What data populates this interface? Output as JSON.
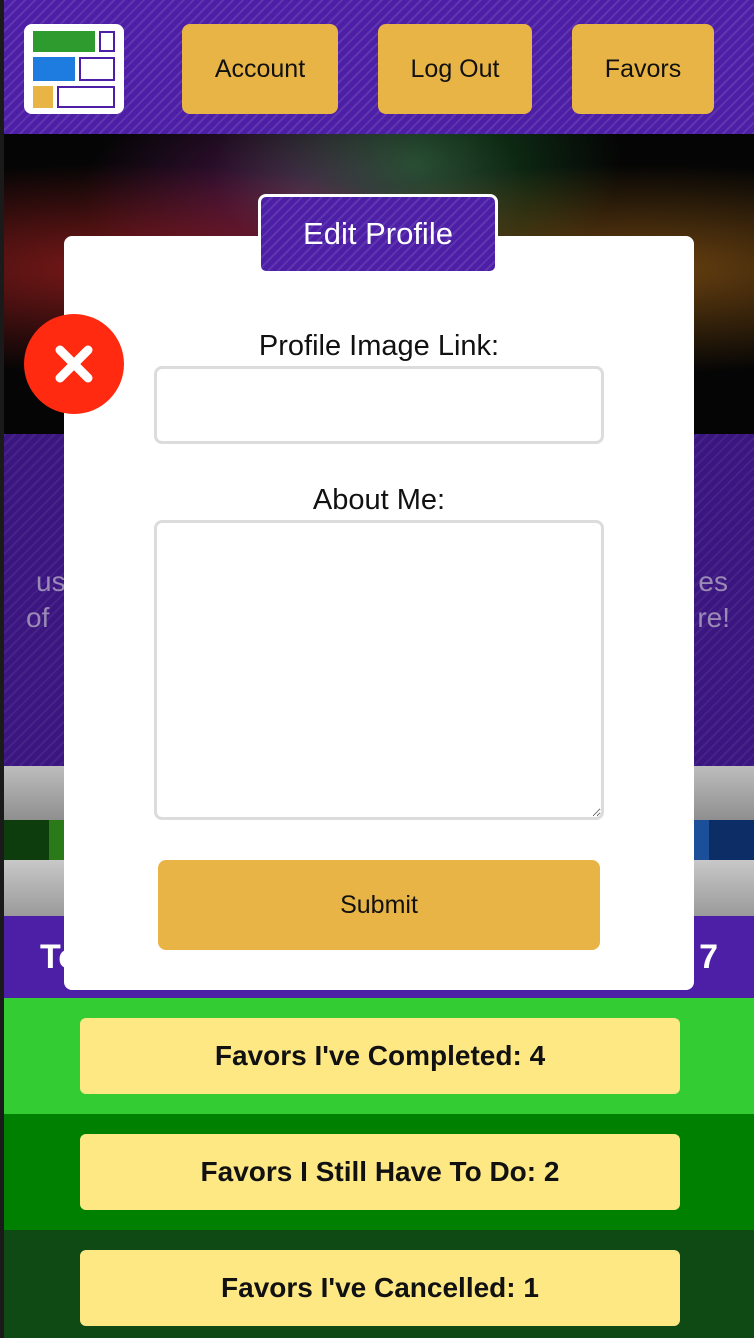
{
  "header": {
    "logo_icon": "grid-logo-icon",
    "nav": [
      {
        "label": "Account"
      },
      {
        "label": "Log Out"
      },
      {
        "label": "Favors"
      }
    ]
  },
  "background": {
    "about_fragments": {
      "left_line1": "us",
      "left_line2": "of",
      "right_line1": "es",
      "right_line2": "re!"
    },
    "total": {
      "left_fragment": "To",
      "right_fragment": "7"
    }
  },
  "stats": [
    {
      "label": "Favors I've Completed: 4",
      "color": "#33cc33"
    },
    {
      "label": "Favors I Still Have To Do: 2",
      "color": "#008000"
    },
    {
      "label": "Favors I've Cancelled: 1",
      "color": "#0f4a14"
    }
  ],
  "modal": {
    "title": "Edit Profile",
    "close_icon": "close-x-icon",
    "fields": {
      "image_link_label": "Profile Image Link:",
      "image_link_value": "",
      "about_label": "About Me:",
      "about_value": ""
    },
    "submit_label": "Submit"
  },
  "colors": {
    "header_purple": "#4d1fa6",
    "button_gold": "#e8b445",
    "stat_yellow": "#fde884",
    "close_red": "#ff2a0f"
  }
}
